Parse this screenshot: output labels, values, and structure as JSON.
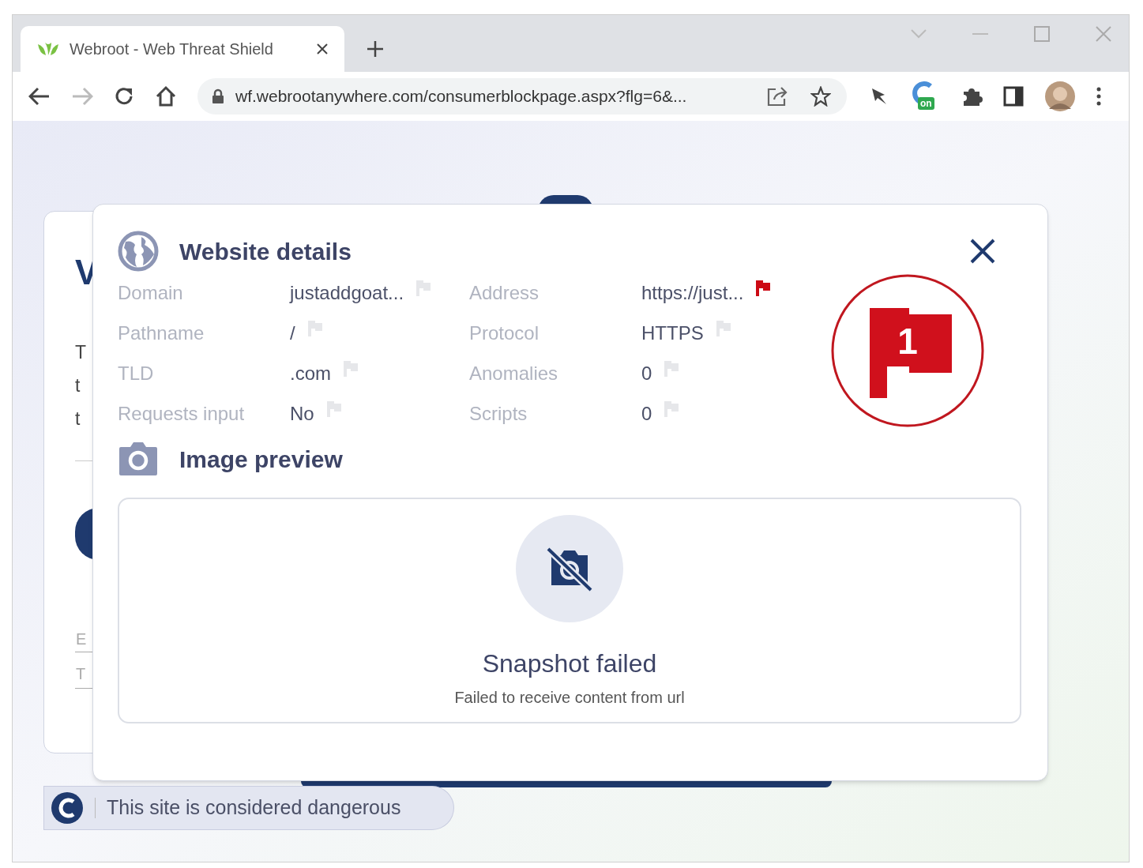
{
  "browser": {
    "tab": {
      "title": "Webroot - Web Threat Shield",
      "selected": true
    },
    "address": "wf.webrootanywhere.com/consumerblockpage.aspx?flg=6&...",
    "extension_badge": "on"
  },
  "background_card": {
    "fragments": [
      "V",
      "T",
      "t",
      "t",
      "E",
      "T"
    ]
  },
  "dialog": {
    "title": "Website details",
    "details": [
      {
        "label": "Domain",
        "value": "justaddgoat...",
        "flagged": false
      },
      {
        "label": "Address",
        "value": "https://just...",
        "flagged": true
      },
      {
        "label": "Pathname",
        "value": "/",
        "flagged": false
      },
      {
        "label": "Protocol",
        "value": "HTTPS",
        "flagged": false
      },
      {
        "label": "TLD",
        "value": ".com",
        "flagged": false
      },
      {
        "label": "Anomalies",
        "value": "0",
        "flagged": false
      },
      {
        "label": "Requests input",
        "value": "No",
        "flagged": false
      },
      {
        "label": "Scripts",
        "value": "0",
        "flagged": false
      }
    ],
    "flag_count": "1",
    "preview_title": "Image preview",
    "snapshot": {
      "title": "Snapshot failed",
      "message": "Failed to receive content from url"
    }
  },
  "status_pill": "This site is considered dangerous"
}
